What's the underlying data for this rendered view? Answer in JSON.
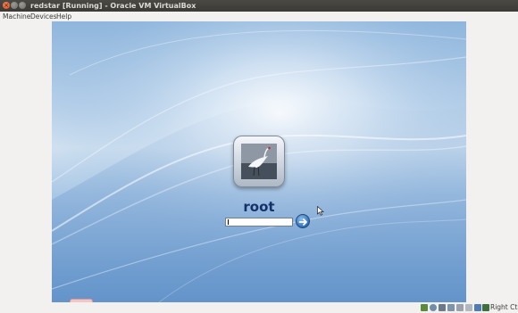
{
  "window": {
    "title": "redstar [Running] - Oracle VM VirtualBox"
  },
  "menu": {
    "machine": "Machine",
    "devices": "Devices",
    "help": "Help"
  },
  "login": {
    "username": "root",
    "password_value": ""
  },
  "statusbar": {
    "host_key": "Right Ctrl",
    "icons": [
      "hard-disk-icon",
      "optical-drive-icon",
      "audio-icon",
      "network-icon",
      "usb-icon",
      "shared-folders-icon",
      "display-icon",
      "video-capture-icon",
      "virtualization-icon",
      "mouse-integration-icon"
    ]
  },
  "colors": {
    "username": "#16316a",
    "close_button": "#dd4814",
    "titlebar": "#3b3a36"
  }
}
